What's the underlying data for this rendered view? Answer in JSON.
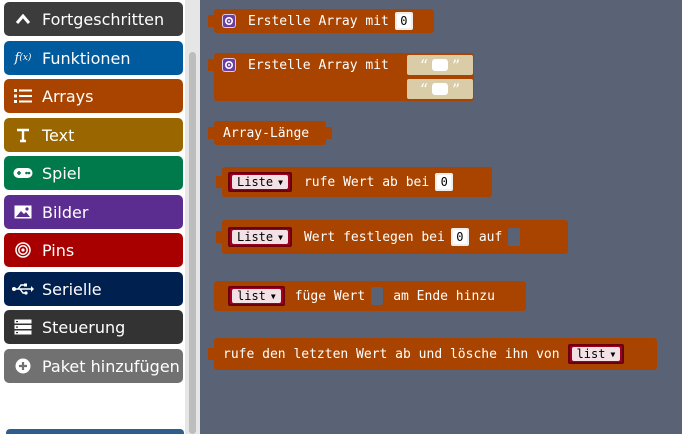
{
  "sidebar": {
    "categories": [
      {
        "key": "advanced",
        "label": "Fortgeschritten",
        "icon": "chevron-up-icon",
        "color": "#3c3c3c"
      },
      {
        "key": "functions",
        "label": "Funktionen",
        "icon": "function-icon",
        "color": "#005a9e"
      },
      {
        "key": "arrays",
        "label": "Arrays",
        "icon": "list-icon",
        "color": "#a94400"
      },
      {
        "key": "text",
        "label": "Text",
        "icon": "text-icon",
        "color": "#996600"
      },
      {
        "key": "game",
        "label": "Spiel",
        "icon": "gamepad-icon",
        "color": "#007a4b"
      },
      {
        "key": "images",
        "label": "Bilder",
        "icon": "image-icon",
        "color": "#5c2d91"
      },
      {
        "key": "pins",
        "label": "Pins",
        "icon": "pin-target-icon",
        "color": "#a80000"
      },
      {
        "key": "serial",
        "label": "Serielle",
        "icon": "usb-icon",
        "color": "#002050"
      },
      {
        "key": "control",
        "label": "Steuerung",
        "icon": "storage-icon",
        "color": "#333333"
      },
      {
        "key": "extension",
        "label": "Paket hinzufügen",
        "icon": "plus-circle-icon",
        "color": "#717171"
      }
    ]
  },
  "blocks": {
    "create_array": {
      "label": "Erstelle Array mit",
      "value": "0"
    },
    "create_array_strings": {
      "label": "Erstelle Array mit",
      "open_quote": "“",
      "close_quote": "”"
    },
    "array_length": {
      "label": "Array-Länge"
    },
    "get_value": {
      "var": "Liste",
      "label": "rufe Wert ab bei",
      "index": "0"
    },
    "set_value": {
      "var": "Liste",
      "label": "Wert festlegen bei",
      "index": "0",
      "label2": "auf"
    },
    "push": {
      "var": "list",
      "label": "füge Wert",
      "label2": "am Ende hinzu"
    },
    "pop": {
      "label": "rufe den letzten Wert ab und lösche ihn von",
      "var": "list"
    }
  },
  "colors": {
    "arrays_block": "#a94400",
    "workspace": "#5a6276",
    "variable": "#a00020"
  }
}
